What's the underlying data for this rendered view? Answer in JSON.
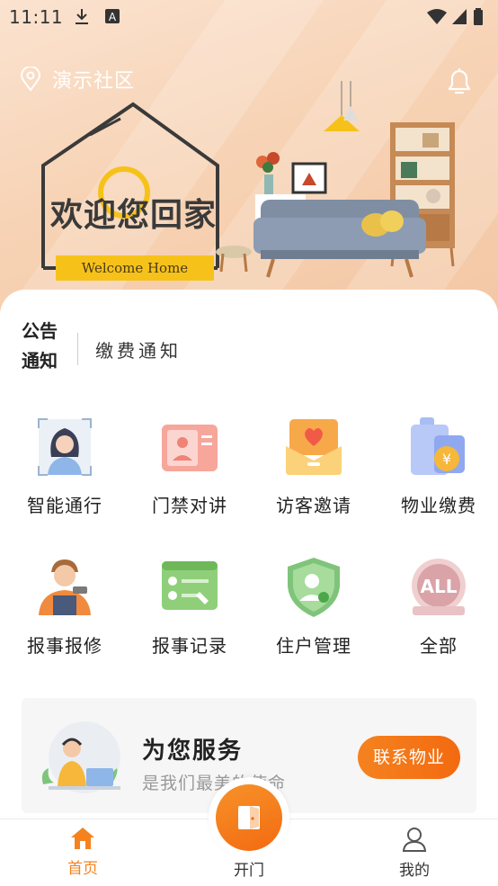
{
  "status_bar": {
    "time": "11:11"
  },
  "header": {
    "community_name": "演示社区",
    "welcome_cn": "欢迎您回家",
    "welcome_en": "Welcome Home"
  },
  "notice": {
    "label": "公告通知",
    "text": "缴费通知"
  },
  "grid": [
    {
      "label": "智能通行",
      "icon": "face-recognition-icon"
    },
    {
      "label": "门禁对讲",
      "icon": "intercom-card-icon"
    },
    {
      "label": "访客邀请",
      "icon": "invitation-envelope-icon"
    },
    {
      "label": "物业缴费",
      "icon": "payment-yen-icon"
    },
    {
      "label": "报事报修",
      "icon": "repair-worker-icon"
    },
    {
      "label": "报事记录",
      "icon": "record-checklist-icon"
    },
    {
      "label": "住户管理",
      "icon": "resident-shield-icon"
    },
    {
      "label": "全部",
      "icon": "all-icon"
    }
  ],
  "service": {
    "title": "为您服务",
    "subtitle": "是我们最美的使命",
    "button": "联系物业"
  },
  "tabbar": {
    "home": "首页",
    "open": "开门",
    "me": "我的"
  },
  "colors": {
    "accent": "#f5821f",
    "banner": "#f7d3b5"
  }
}
